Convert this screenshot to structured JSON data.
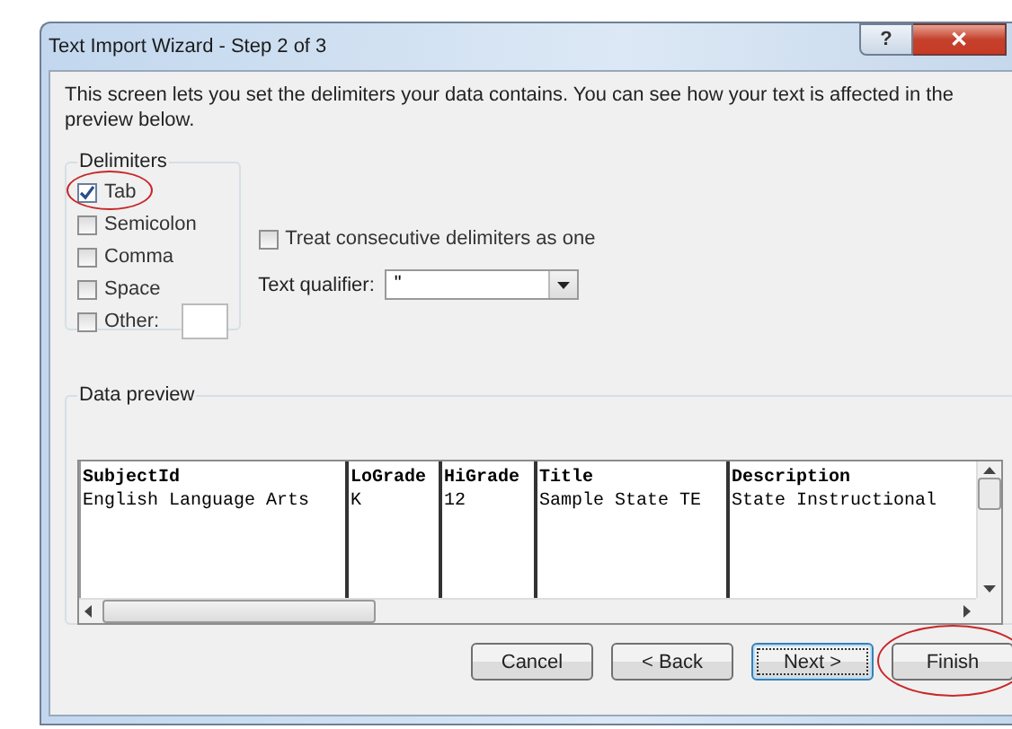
{
  "window": {
    "title": "Text Import Wizard - Step 2 of 3",
    "help_button": "?",
    "close_button": "✕"
  },
  "instructions": "This screen lets you set the delimiters your data contains.  You can see how your text is affected in the preview below.",
  "delimiters": {
    "title": "Delimiters",
    "options": [
      {
        "label": "Tab",
        "kind": "plain",
        "checked": true,
        "circled": true
      },
      {
        "label": "Semicolon",
        "kind": "plain",
        "checked": false,
        "circled": false
      },
      {
        "label": "Comma",
        "kind": "plain",
        "checked": false,
        "circled": false
      },
      {
        "label": "Space",
        "kind": "plain",
        "checked": false,
        "circled": false
      },
      {
        "label": "Other:",
        "kind": "other",
        "checked": false,
        "circled": false
      }
    ]
  },
  "treat_consecutive": {
    "label": "Treat consecutive delimiters as one",
    "checked": false
  },
  "text_qualifier": {
    "label": "Text qualifier:",
    "value": "\""
  },
  "data_preview": {
    "title": "Data preview",
    "columns": [
      "SubjectId",
      "LoGrade",
      "HiGrade",
      "Title",
      "Description"
    ],
    "rows": [
      [
        "English Language Arts",
        "K",
        "12",
        "Sample State TE",
        "State Instructional"
      ]
    ]
  },
  "buttons": [
    {
      "label": "Cancel",
      "default": false,
      "circled": false
    },
    {
      "label": "< Back",
      "default": false,
      "circled": false
    },
    {
      "label": "Next >",
      "default": true,
      "circled": false
    },
    {
      "label": "Finish",
      "default": false,
      "circled": true
    }
  ]
}
